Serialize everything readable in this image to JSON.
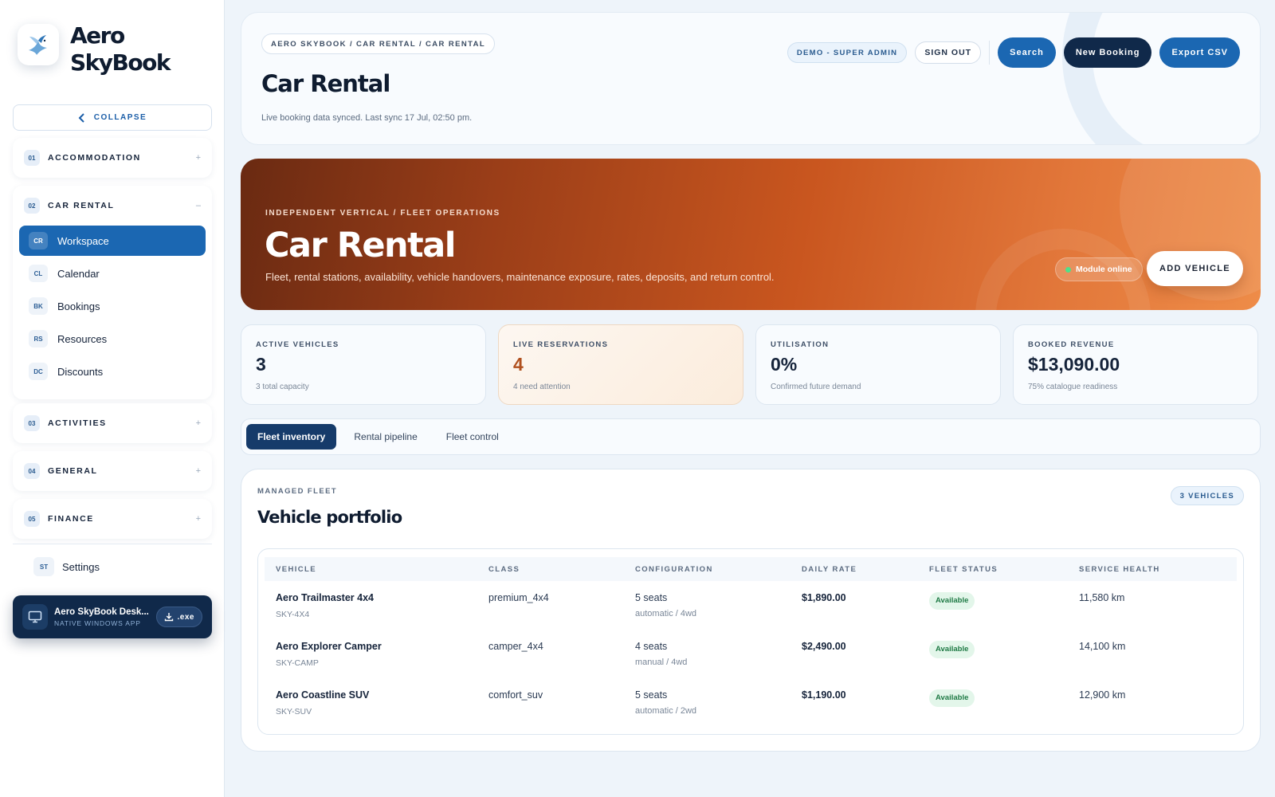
{
  "brand": {
    "name": "Aero SkyBook"
  },
  "sidebar": {
    "collapse_label": "COLLAPSE",
    "groups": [
      {
        "num": "01",
        "title": "ACCOMMODATION",
        "toggle": "+"
      },
      {
        "num": "02",
        "title": "CAR RENTAL",
        "toggle": "–",
        "items": [
          {
            "abbr": "CR",
            "label": "Workspace",
            "active": true
          },
          {
            "abbr": "CL",
            "label": "Calendar"
          },
          {
            "abbr": "BK",
            "label": "Bookings"
          },
          {
            "abbr": "RS",
            "label": "Resources"
          },
          {
            "abbr": "DC",
            "label": "Discounts"
          }
        ]
      },
      {
        "num": "03",
        "title": "ACTIVITIES",
        "toggle": "+"
      },
      {
        "num": "04",
        "title": "GENERAL",
        "toggle": "+"
      },
      {
        "num": "05",
        "title": "FINANCE",
        "toggle": "+"
      }
    ],
    "settings": {
      "abbr": "ST",
      "label": "Settings"
    },
    "desktop": {
      "title": "Aero SkyBook Desk...",
      "subtitle": "NATIVE WINDOWS APP",
      "button": ".exe"
    }
  },
  "header": {
    "breadcrumb": "AERO SKYBOOK / CAR RENTAL / CAR RENTAL",
    "title": "Car Rental",
    "sync_text": "Live booking data synced. Last sync 17 Jul, 02:50 pm.",
    "role_badge": "DEMO - SUPER ADMIN",
    "sign_out": "SIGN OUT",
    "search": "Search",
    "new_booking": "New Booking",
    "export": "Export CSV"
  },
  "hero": {
    "eyebrow": "INDEPENDENT VERTICAL / FLEET OPERATIONS",
    "title": "Car Rental",
    "description": "Fleet, rental stations, availability, vehicle handovers, maintenance exposure, rates, deposits, and return control.",
    "status": "Module online",
    "add_vehicle": "ADD VEHICLE"
  },
  "stats": [
    {
      "label": "ACTIVE VEHICLES",
      "value": "3",
      "sub": "3 total capacity"
    },
    {
      "label": "LIVE RESERVATIONS",
      "value": "4",
      "sub": "4 need attention"
    },
    {
      "label": "UTILISATION",
      "value": "0%",
      "sub": "Confirmed future demand"
    },
    {
      "label": "BOOKED REVENUE",
      "value": "$13,090.00",
      "sub": "75% catalogue readiness"
    }
  ],
  "tabs": [
    "Fleet inventory",
    "Rental pipeline",
    "Fleet control"
  ],
  "fleet": {
    "eyebrow": "MANAGED FLEET",
    "title": "Vehicle portfolio",
    "count": "3 VEHICLES",
    "columns": [
      "VEHICLE",
      "CLASS",
      "CONFIGURATION",
      "DAILY RATE",
      "FLEET STATUS",
      "SERVICE HEALTH"
    ],
    "rows": [
      {
        "name": "Aero Trailmaster 4x4",
        "code": "SKY-4X4",
        "class": "premium_4x4",
        "seats": "5 seats",
        "drive": "automatic / 4wd",
        "rate": "$1,890.00",
        "status": "Available",
        "health": "11,580 km"
      },
      {
        "name": "Aero Explorer Camper",
        "code": "SKY-CAMP",
        "class": "camper_4x4",
        "seats": "4 seats",
        "drive": "manual / 4wd",
        "rate": "$2,490.00",
        "status": "Available",
        "health": "14,100 km"
      },
      {
        "name": "Aero Coastline SUV",
        "code": "SKY-SUV",
        "class": "comfort_suv",
        "seats": "5 seats",
        "drive": "automatic / 2wd",
        "rate": "$1,190.00",
        "status": "Available",
        "health": "12,900 km"
      }
    ]
  },
  "colors": {
    "primary": "#1b67b2",
    "navy": "#10294a",
    "hero_start": "#6a2a12",
    "hero_end": "#ee8c48",
    "success": "#1f7a45"
  }
}
